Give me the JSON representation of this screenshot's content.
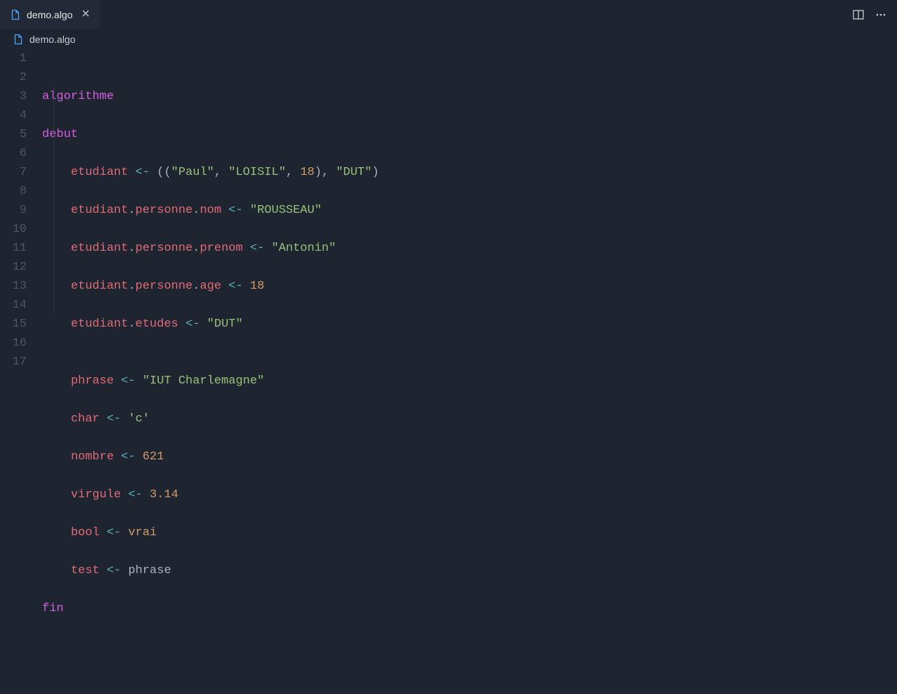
{
  "tab": {
    "filename": "demo.algo"
  },
  "breadcrumb": {
    "filename": "demo.algo"
  },
  "code": {
    "line1": {
      "keyword": "algorithme"
    },
    "line2": {
      "keyword": "debut"
    },
    "line3": {
      "var": "etudiant",
      "op": "<-",
      "p1": "((",
      "str1": "\"Paul\"",
      "c1": ", ",
      "str2": "\"LOISIL\"",
      "c2": ", ",
      "num1": "18",
      "p2": ")",
      "c3": ", ",
      "str3": "\"DUT\"",
      "p3": ")"
    },
    "line4": {
      "var": "etudiant",
      "d1": ".",
      "p1": "personne",
      "d2": ".",
      "p2": "nom",
      "op": "<-",
      "str": "\"ROUSSEAU\""
    },
    "line5": {
      "var": "etudiant",
      "d1": ".",
      "p1": "personne",
      "d2": ".",
      "p2": "prenom",
      "op": "<-",
      "str": "\"Antonin\""
    },
    "line6": {
      "var": "etudiant",
      "d1": ".",
      "p1": "personne",
      "d2": ".",
      "p2": "age",
      "op": "<-",
      "num": "18"
    },
    "line7": {
      "var": "etudiant",
      "d1": ".",
      "p1": "etudes",
      "op": "<-",
      "str": "\"DUT\""
    },
    "line8": {
      "blank": ""
    },
    "line9": {
      "var": "phrase",
      "op": "<-",
      "str": "\"IUT Charlemagne\""
    },
    "line10": {
      "var": "char",
      "op": "<-",
      "str": "'c'"
    },
    "line11": {
      "var": "nombre",
      "op": "<-",
      "num": "621"
    },
    "line12": {
      "var": "virgule",
      "op": "<-",
      "num": "3.14"
    },
    "line13": {
      "var": "bool",
      "op": "<-",
      "val": "vrai"
    },
    "line14": {
      "var": "test",
      "op": "<-",
      "val": "phrase"
    },
    "line15": {
      "keyword": "fin"
    },
    "line16": {
      "blank": ""
    },
    "line17": {
      "blank": ""
    }
  },
  "lineNumbers": [
    "1",
    "2",
    "3",
    "4",
    "5",
    "6",
    "7",
    "8",
    "9",
    "10",
    "11",
    "12",
    "13",
    "14",
    "15",
    "16",
    "17"
  ]
}
